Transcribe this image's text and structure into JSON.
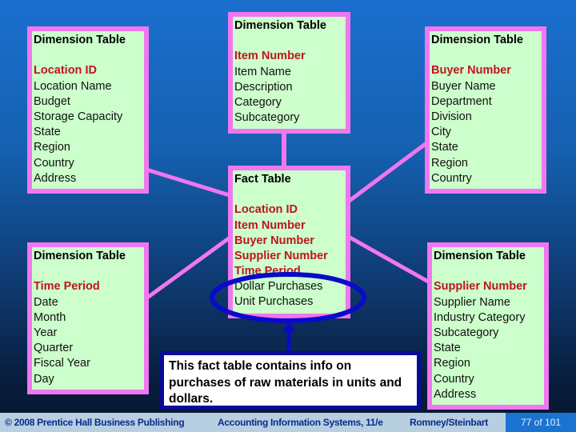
{
  "colors": {
    "box_fill": "#ccffcc",
    "box_border": "#f077f0",
    "key_text": "#c0141c",
    "ellipse": "#0a0ac8",
    "callout_border": "#0a0a9a"
  },
  "dimension_tables": {
    "location": {
      "title": "Dimension Table",
      "key": "Location ID",
      "attributes": [
        "Location Name",
        "Budget",
        "Storage Capacity",
        "State",
        "Region",
        "Country",
        "Address"
      ]
    },
    "item": {
      "title": "Dimension Table",
      "key": "Item Number",
      "attributes": [
        "Item Name",
        "Description",
        "Category",
        "Subcategory"
      ]
    },
    "buyer": {
      "title": "Dimension Table",
      "key": "Buyer Number",
      "attributes": [
        "Buyer Name",
        "Department",
        "Division",
        "City",
        "State",
        "Region",
        "Country"
      ]
    },
    "time": {
      "title": "Dimension Table",
      "key": "Time Period",
      "attributes": [
        "Date",
        "Month",
        "Year",
        "Quarter",
        "Fiscal Year",
        "Day"
      ]
    },
    "supplier": {
      "title": "Dimension Table",
      "key": "Supplier Number",
      "attributes": [
        "Supplier Name",
        "Industry Category",
        "Subcategory",
        "State",
        "Region",
        "Country",
        "Address"
      ]
    }
  },
  "fact_table": {
    "title": "Fact Table",
    "keys": [
      "Location ID",
      "Item Number",
      "Buyer Number",
      "Supplier Number",
      "Time Period"
    ],
    "measures": [
      "Dollar Purchases",
      "Unit Purchases"
    ]
  },
  "callout": {
    "text": "This fact table contains info on purchases of raw materials in units and dollars."
  },
  "footer": {
    "copyright": "© 2008 Prentice Hall Business Publishing",
    "book": "Accounting Information Systems, 11/e",
    "authors": "Romney/Steinbart",
    "page": "77 of 101"
  }
}
